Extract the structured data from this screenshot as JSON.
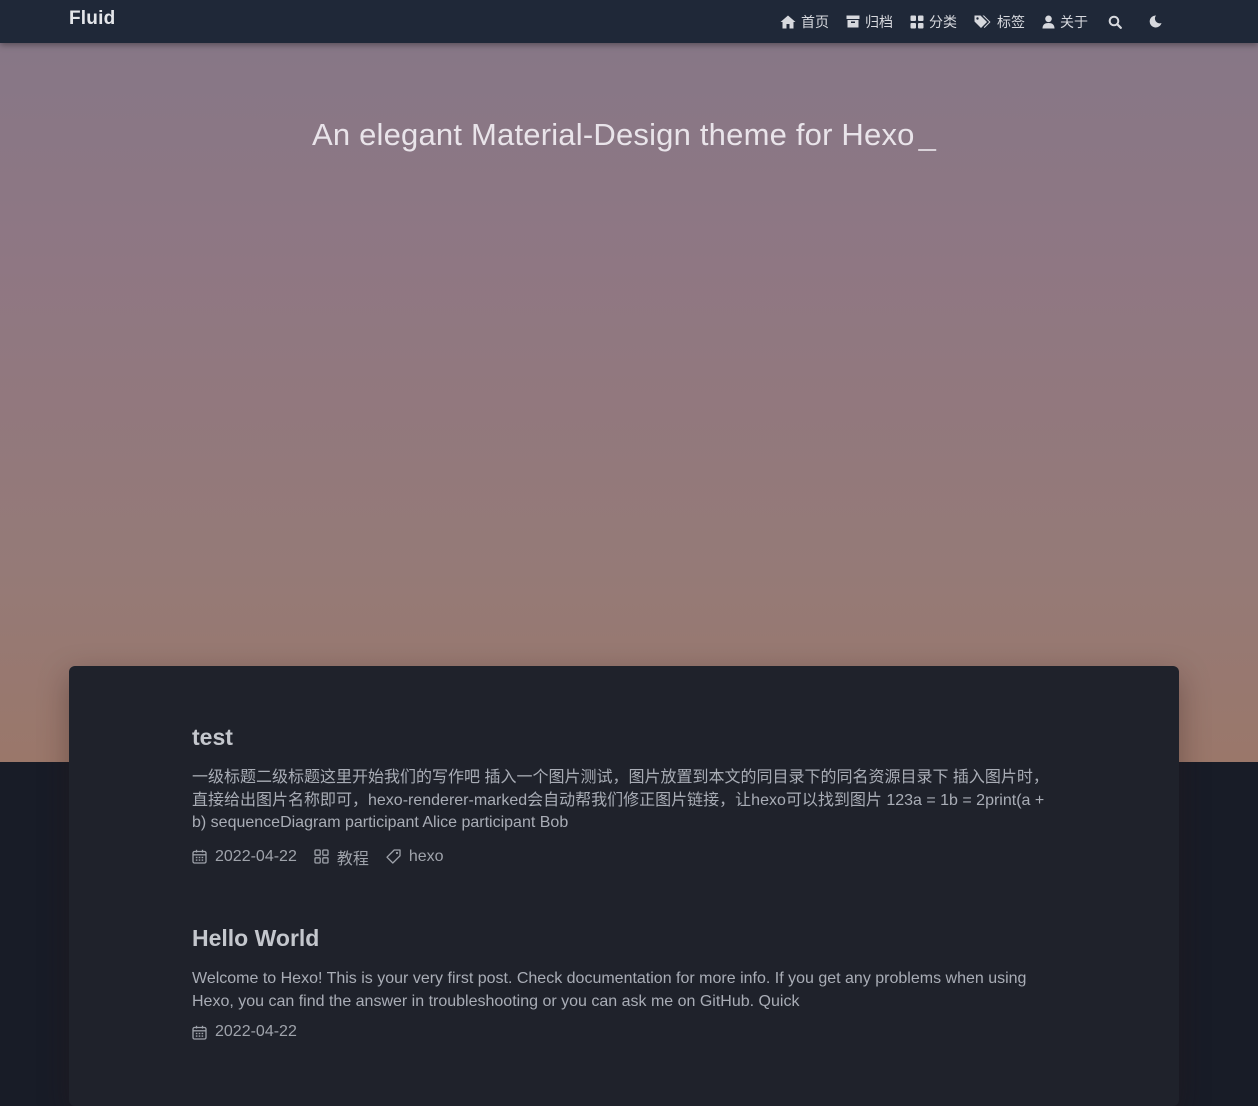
{
  "navbar": {
    "brand": "Fluid",
    "items": [
      {
        "label": "首页",
        "icon": "home-icon"
      },
      {
        "label": "归档",
        "icon": "archive-icon"
      },
      {
        "label": "分类",
        "icon": "category-icon"
      },
      {
        "label": "标签",
        "icon": "tags-icon"
      },
      {
        "label": "关于",
        "icon": "user-icon"
      }
    ],
    "search_icon": "search-icon",
    "theme_icon": "moon-icon"
  },
  "banner": {
    "subtitle": "An elegant Material-Design theme for Hexo",
    "cursor": "_"
  },
  "posts": [
    {
      "title": "test",
      "excerpt": "一级标题二级标题这里开始我们的写作吧 插入一个图片测试，图片放置到本文的同目录下的同名资源目录下 插入图片时，直接给出图片名称即可，hexo-renderer-marked会自动帮我们修正图片链接，让hexo可以找到图片 123a = 1b = 2print(a + b) sequenceDiagram participant Alice participant Bob",
      "date": "2022-04-22",
      "category": "教程",
      "tag": "hexo"
    },
    {
      "title": "Hello World",
      "excerpt": "Welcome to Hexo! This is your very first post. Check documentation for more info. If you get any problems when using Hexo, you can find the answer in troubleshooting or you can ask me on GitHub. Quick",
      "date": "2022-04-22"
    }
  ],
  "colors": {
    "navbar_bg": "#1f2838",
    "board_bg": "#1f222b",
    "page_bg": "#181c27"
  }
}
